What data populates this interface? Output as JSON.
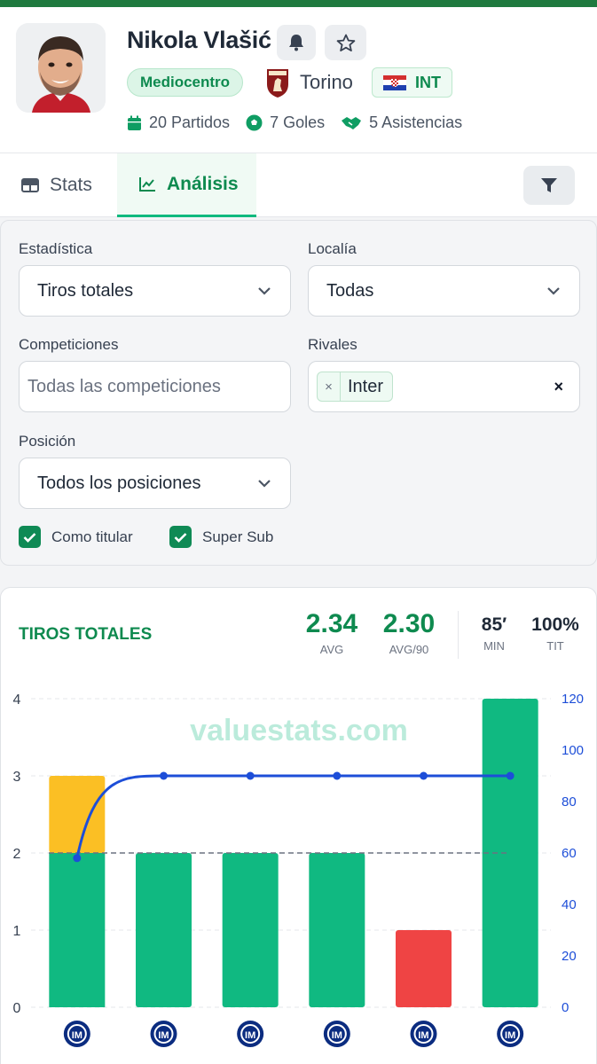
{
  "player": {
    "name": "Nikola Vlašić",
    "position": "Mediocentro",
    "club": "Torino",
    "nationality_code": "INT",
    "stats": {
      "matches": "20 Partidos",
      "goals": "7 Goles",
      "assists": "5 Asistencias"
    }
  },
  "icons": {
    "bell": "bell-icon",
    "star": "star-icon",
    "calendar": "calendar-icon",
    "ball": "soccer-ball-icon",
    "assist": "handshake-icon",
    "table": "table-icon",
    "chart": "chart-line-icon",
    "filter": "filter-icon"
  },
  "tabs": {
    "stats": "Stats",
    "analysis": "Análisis"
  },
  "filters": {
    "stat_label": "Estadística",
    "stat_value": "Tiros totales",
    "venue_label": "Localía",
    "venue_value": "Todas",
    "comp_label": "Competiciones",
    "comp_placeholder": "Todas las competiciones",
    "rivals_label": "Rivales",
    "rival_chip": "Inter",
    "chip_remove": "×",
    "clear": "×",
    "position_label": "Posición",
    "position_value": "Todos los posiciones",
    "starter_label": "Como titular",
    "supersub_label": "Super Sub"
  },
  "summary": {
    "title": "TIROS TOTALES",
    "avg": "2.34",
    "avg_label": "AVG",
    "avg90": "2.30",
    "avg90_label": "AVG/90",
    "min": "85′",
    "min_label": "MIN",
    "tit": "100%",
    "tit_label": "TIT"
  },
  "watermark": "valuestats.com",
  "colors": {
    "green": "#10b981",
    "yellow": "#fbbf24",
    "red": "#ef4444",
    "line": "#1d4ed8",
    "accent": "#0e8a4f",
    "inter_blue": "#0b2c80"
  },
  "chart_data": {
    "type": "bar",
    "categories": [
      "Inter",
      "Inter",
      "Inter",
      "Inter",
      "Inter",
      "Inter"
    ],
    "series": [
      {
        "values": [
          3,
          2,
          2,
          2,
          1,
          4
        ],
        "colors": [
          "yellow",
          "green",
          "green",
          "green",
          "red",
          "green"
        ],
        "axis": "left"
      },
      {
        "type": "line",
        "values": [
          58,
          90,
          90,
          90,
          90,
          90
        ],
        "axis": "right"
      }
    ],
    "reference_line": 2,
    "ylim_left": [
      0,
      4
    ],
    "yticks_left": [
      "0",
      "1",
      "2",
      "3",
      "4"
    ],
    "ylim_right": [
      0,
      120
    ],
    "yticks_right": [
      "0",
      "20",
      "40",
      "60",
      "80",
      "100",
      "120"
    ],
    "grid": true
  }
}
